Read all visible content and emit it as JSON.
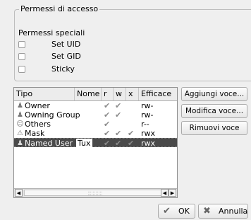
{
  "group": {
    "title": "Permessi di accesso",
    "special_label": "Permessi speciali",
    "checkboxes": [
      {
        "label": "Set UID",
        "checked": false
      },
      {
        "label": "Set GID",
        "checked": false
      },
      {
        "label": "Sticky",
        "checked": false
      }
    ]
  },
  "table": {
    "headers": [
      "Tipo",
      "Nome",
      "r",
      "w",
      "x",
      "Efficace"
    ],
    "rows": [
      {
        "tipo": "Owner",
        "nome": "",
        "r": "✔",
        "w": "✔",
        "x": "",
        "efficace": "rw-",
        "icon": "user-icon"
      },
      {
        "tipo": "Owning Group",
        "nome": "",
        "r": "✔",
        "w": "✔",
        "x": "",
        "efficace": "rw-",
        "icon": "group-icon"
      },
      {
        "tipo": "Others",
        "nome": "",
        "r": "✔",
        "w": "",
        "x": "",
        "efficace": "r--",
        "icon": "others-icon"
      },
      {
        "tipo": "Mask",
        "nome": "",
        "r": "✔",
        "w": "✔",
        "x": "✔",
        "efficace": "rwx",
        "icon": "warning-icon"
      },
      {
        "tipo": "Named User",
        "nome": "Tux",
        "r": "✔",
        "w": "✔",
        "x": "✔",
        "efficace": "rwx",
        "icon": "user-icon",
        "selected": true
      }
    ]
  },
  "buttons": {
    "add": "Aggiungi voce...",
    "modify": "Modifica voce...",
    "remove": "Rimuovi voce",
    "ok": "OK",
    "cancel": "Annulla"
  }
}
